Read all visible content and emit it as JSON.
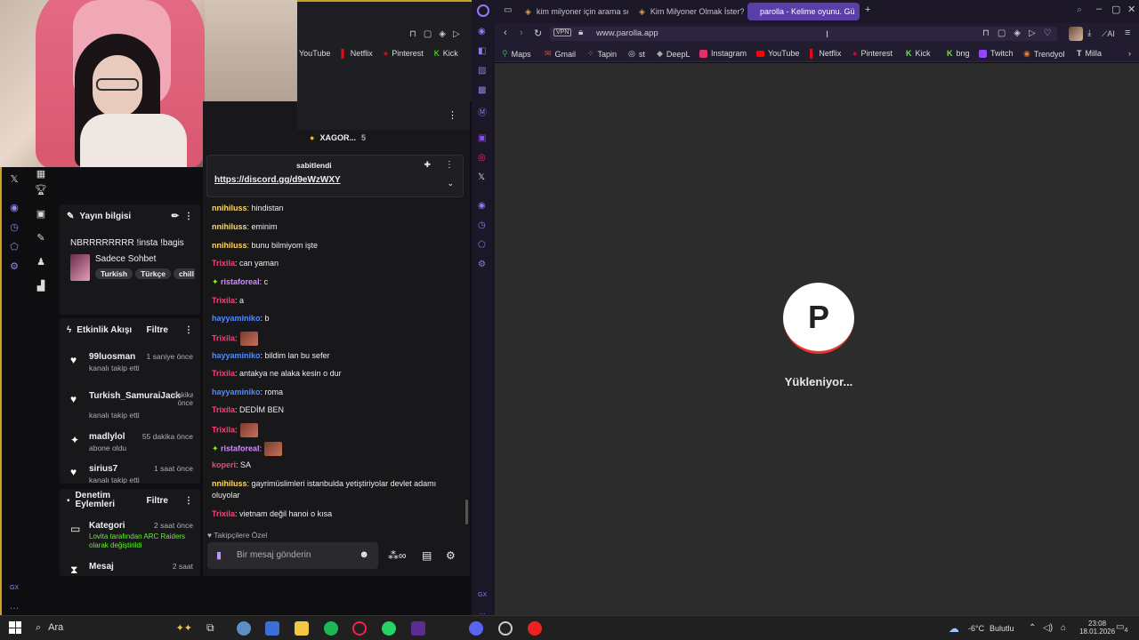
{
  "left_browser": {
    "bookmarks": [
      "YouTube",
      "Netflix",
      "Pinterest",
      "Kick"
    ]
  },
  "chat": {
    "top_user": "XAGOR...",
    "top_count": "5",
    "pinned_label": "sabitlendi",
    "pinned_link": "https://discord.gg/d9eWzWXY",
    "messages": [
      {
        "user": "nnihiluss",
        "color": "#ffd966",
        "text": ": hindistan"
      },
      {
        "user": "nnihiluss",
        "color": "#ffd966",
        "text": ": eminim"
      },
      {
        "user": "nnihiluss",
        "color": "#ffd966",
        "text": ": bunu bilmiyom işte"
      },
      {
        "user": "Trixila",
        "color": "#ff3f7a",
        "text": ": can yaman"
      },
      {
        "user": "ristaforeal",
        "color": "#d08cff",
        "text": ": c"
      },
      {
        "user": "Trixila",
        "color": "#ff3f7a",
        "text": ": a"
      },
      {
        "user": "hayyaminiko",
        "color": "#4f8cff",
        "text": ": b"
      },
      {
        "user": "Trixila",
        "color": "#ff3f7a",
        "text": ":"
      },
      {
        "user": "hayyaminiko",
        "color": "#4f8cff",
        "text": ": bildim lan bu sefer"
      },
      {
        "user": "Trixila",
        "color": "#ff3f7a",
        "text": ": antakya ne alaka kesin o dur"
      },
      {
        "user": "hayyaminiko",
        "color": "#4f8cff",
        "text": ": roma"
      },
      {
        "user": "Trixila",
        "color": "#ff3f7a",
        "text": ": DEDİM BEN"
      },
      {
        "user": "Trixila",
        "color": "#ff3f7a",
        "text": ":"
      },
      {
        "user": "ristaforeal",
        "color": "#d08cff",
        "text": ":"
      },
      {
        "user": "koperi",
        "color": "#ff3f7a",
        "text": ": SA"
      },
      {
        "user": "nnihiluss",
        "color": "#ffd966",
        "text": ": gayrimüslimleri istanbulda yetiştiriyolar devlet adamı oluyolar"
      },
      {
        "user": "Trixila",
        "color": "#ff3f7a",
        "text": ": vietnam değil hanoi o kısa"
      }
    ],
    "followers_only": "Takipçilere Özel",
    "input_placeholder": "Bir mesaj gönderin"
  },
  "stream_info": {
    "title": "Yayın bilgisi",
    "stream_title": "NBRRRRRRRR !insta !bagis",
    "category": "Sadece Sohbet",
    "tags": [
      "Turkish",
      "Türkçe",
      "chill"
    ]
  },
  "activity": {
    "title": "Etkinlik Akışı",
    "filter": "Filtre",
    "items": [
      {
        "name": "99luosman",
        "time": "1 saniye önce",
        "sub": "kanalı takip etti"
      },
      {
        "name": "Turkish_SamuraiJack",
        "time": "dakika önce",
        "sub": "kanalı takip etti"
      },
      {
        "name": "madlylol",
        "time": "55 dakika önce",
        "sub": "abone oldu"
      },
      {
        "name": "sirius7",
        "time": "1 saat önce",
        "sub": "kanalı takip etti"
      }
    ]
  },
  "mod": {
    "title": "Denetim Eylemleri",
    "filter": "Filtre",
    "items": [
      {
        "name": "Kategori",
        "time": "2 saat önce",
        "sub": "Lovita tarafından ARC Raiders olarak değiştirildi"
      },
      {
        "name": "Mesaj",
        "time": "2 saat"
      }
    ]
  },
  "right_browser": {
    "tabs": [
      "kim milyoner için arama so",
      "Kim Milyoner Olmak İster?",
      "parolla - Kelime oyunu. Gü"
    ],
    "vpn": "VPN",
    "url": "www.parolla.app",
    "ai": "AI",
    "bookmarks": [
      "Maps",
      "Gmail",
      "Tapin",
      "st",
      "DeepL",
      "Instagram",
      "YouTube",
      "Netflix",
      "Pinterest",
      "Kick",
      "bng",
      "Twitch",
      "Trendyol",
      "Milla"
    ],
    "logo_letter": "P",
    "loading": "Yükleniyor..."
  },
  "taskbar": {
    "search": "Ara",
    "weather": "-6°C",
    "weather_text": "Bulutlu",
    "time": "23:08",
    "date": "18.01.2026",
    "notif": "4"
  }
}
